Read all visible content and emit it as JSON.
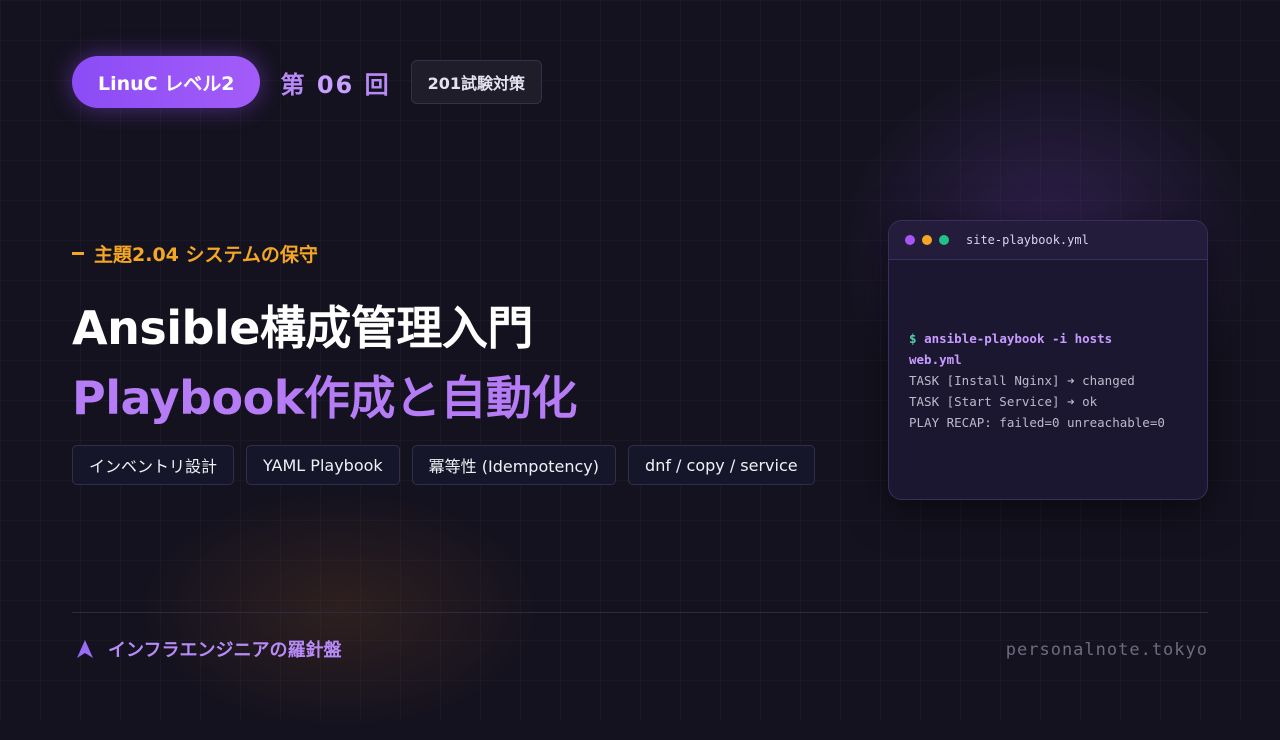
{
  "header": {
    "level_label": "LinuC レベル2",
    "episode_prefix": "第",
    "episode_number": "06",
    "episode_suffix": "回",
    "exam_label": "201試験対策"
  },
  "topic": "主題2.04 システムの保守",
  "title_line1": "Ansible構成管理入門",
  "title_line2": "Playbook作成と自動化",
  "tags": [
    "インベントリ設計",
    "YAML Playbook",
    "冪等性 (Idempotency)",
    "dnf / copy / service"
  ],
  "terminal": {
    "filename": "site-playbook.yml",
    "prompt": "$",
    "command_line1": "ansible-playbook -i hosts",
    "command_line2": "web.yml",
    "output": [
      "TASK [Install Nginx] ➜ changed",
      "TASK [Start Service] ➜ ok",
      "PLAY RECAP: failed=0 unreachable=0"
    ]
  },
  "footer": {
    "brand": "インフラエンジニアの羅針盤",
    "site": "personalnote.tokyo"
  },
  "colors": {
    "accent_purple": "#a35cf8",
    "accent_orange": "#f5a623",
    "dot_red": "#a855f7",
    "dot_yellow": "#f5a623",
    "dot_green": "#22c08a"
  }
}
